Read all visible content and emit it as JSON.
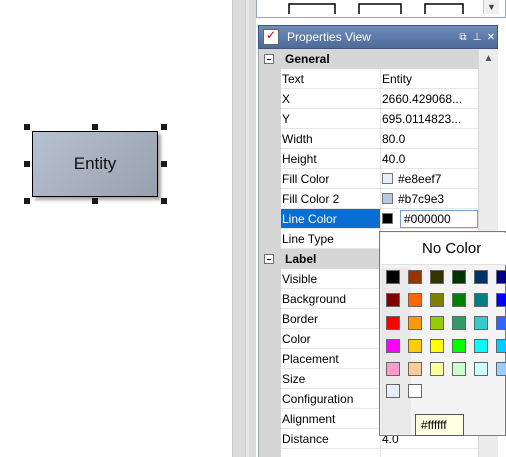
{
  "canvas": {
    "entity_label": "Entity"
  },
  "properties_view": {
    "title": "Properties View",
    "title_buttons": {
      "restore": "⧉",
      "pin": "⊥",
      "close": "✕"
    }
  },
  "sections": [
    {
      "label": "General"
    },
    {
      "label": "Label"
    }
  ],
  "properties": [
    {
      "name": "Text",
      "value": "Entity"
    },
    {
      "name": "X",
      "value": "2660.429068..."
    },
    {
      "name": "Y",
      "value": "695.0114823..."
    },
    {
      "name": "Width",
      "value": "80.0"
    },
    {
      "name": "Height",
      "value": "40.0"
    },
    {
      "name": "Fill Color",
      "value": "#e8eef7",
      "swatch": "#e8eef7"
    },
    {
      "name": "Fill Color 2",
      "value": "#b7c9e3",
      "swatch": "#b7c9e3"
    },
    {
      "name": "Line Color",
      "value": "#000000",
      "swatch": "#000000"
    },
    {
      "name": "Line Type",
      "value": ""
    },
    {
      "name": "Visible",
      "value": ""
    },
    {
      "name": "Background",
      "value": ""
    },
    {
      "name": "Border",
      "value": ""
    },
    {
      "name": "Color",
      "value": ""
    },
    {
      "name": "Placement",
      "value": ""
    },
    {
      "name": "Size",
      "value": ""
    },
    {
      "name": "Configuration",
      "value": ""
    },
    {
      "name": "Alignment",
      "value": ""
    },
    {
      "name": "Distance",
      "value": "4.0"
    }
  ],
  "color_popup": {
    "no_color_label": "No Color",
    "rows": [
      [
        "#000000",
        "#993300",
        "#333300",
        "#003300",
        "#003366",
        "#000080"
      ],
      [
        "#800000",
        "#ff6600",
        "#808000",
        "#008000",
        "#008080",
        "#0000ff"
      ],
      [
        "#ff0000",
        "#ff9900",
        "#99cc00",
        "#339966",
        "#33cccc",
        "#3366ff"
      ],
      [
        "#ff00ff",
        "#ffcc00",
        "#ffff00",
        "#00ff00",
        "#00ffff",
        "#00ccff"
      ],
      [
        "#ff99cc",
        "#ffcc99",
        "#ffff99",
        "#ccffcc",
        "#ccffff",
        "#99ccff"
      ]
    ],
    "recent": [
      "#e8eef7",
      "#ffffff"
    ],
    "tooltip": "#ffffff"
  },
  "colors": {
    "title_bar": "#5a77a8",
    "selection": "#0a6ed1",
    "entity_fill": "#a7b1bf"
  }
}
